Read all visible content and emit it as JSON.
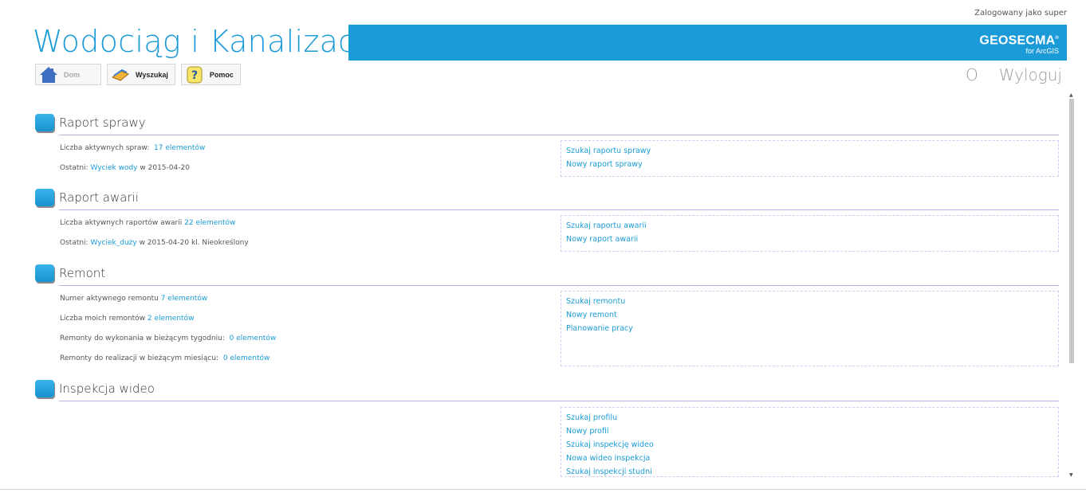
{
  "header": {
    "login_info": "Zalogowany jako super",
    "title": "Wodociąg i Kanalizacja",
    "brand": {
      "name": "GEOSECMA",
      "mark": "®",
      "sub": "for ArcGIS"
    },
    "nav": {
      "about": "O",
      "logout": "Wyloguj"
    }
  },
  "toolbar": {
    "home": "Dom",
    "search": "Wyszukaj",
    "help": "Pomoc"
  },
  "sections": [
    {
      "title": "Raport sprawy",
      "info": [
        {
          "label": "Liczba aktywnych spraw:",
          "link": "17 elementów",
          "suffix": ""
        },
        {
          "label": "Ostatni:",
          "link": "Wyciek wody",
          "suffix": "w 2015-04-20"
        }
      ],
      "links": [
        "Szukaj raportu sprawy",
        "Nowy raport sprawy"
      ]
    },
    {
      "title": "Raport awarii",
      "info": [
        {
          "label": "Liczba aktywnych raportów awarii",
          "link": "22 elementów",
          "suffix": ""
        },
        {
          "label": "Ostatni:",
          "link": "Wyciek_duży",
          "suffix": "w 2015-04-20 kl. Nieokreślony"
        }
      ],
      "links": [
        "Szukaj raportu awarii",
        "Nowy raport awarii"
      ]
    },
    {
      "title": "Remont",
      "info": [
        {
          "label": "Numer aktywnego remontu",
          "link": "7 elementów",
          "suffix": ""
        },
        {
          "label": "Liczba moich remontów",
          "link": "2 elementów",
          "suffix": ""
        },
        {
          "label": "Remonty do wykonania w bieżącym tygodniu:",
          "link": "0 elementów",
          "suffix": ""
        },
        {
          "label": "Remonty do realizacji w bieżącym miesiącu:",
          "link": "0 elementów",
          "suffix": ""
        }
      ],
      "links": [
        "Szukaj remontu",
        "Nowy remont",
        "Planowanie pracy"
      ]
    },
    {
      "title": "Inspekcja wideo",
      "info": [],
      "links": [
        "Szukaj profilu",
        "Nowy profil",
        "Szukaj inspekcję wideo",
        "Nowa wideo inspekcja",
        "Szukaj inspekcji studni"
      ]
    }
  ],
  "colors": {
    "accent": "#1a9bd7",
    "rule": "#b9b2ea"
  }
}
